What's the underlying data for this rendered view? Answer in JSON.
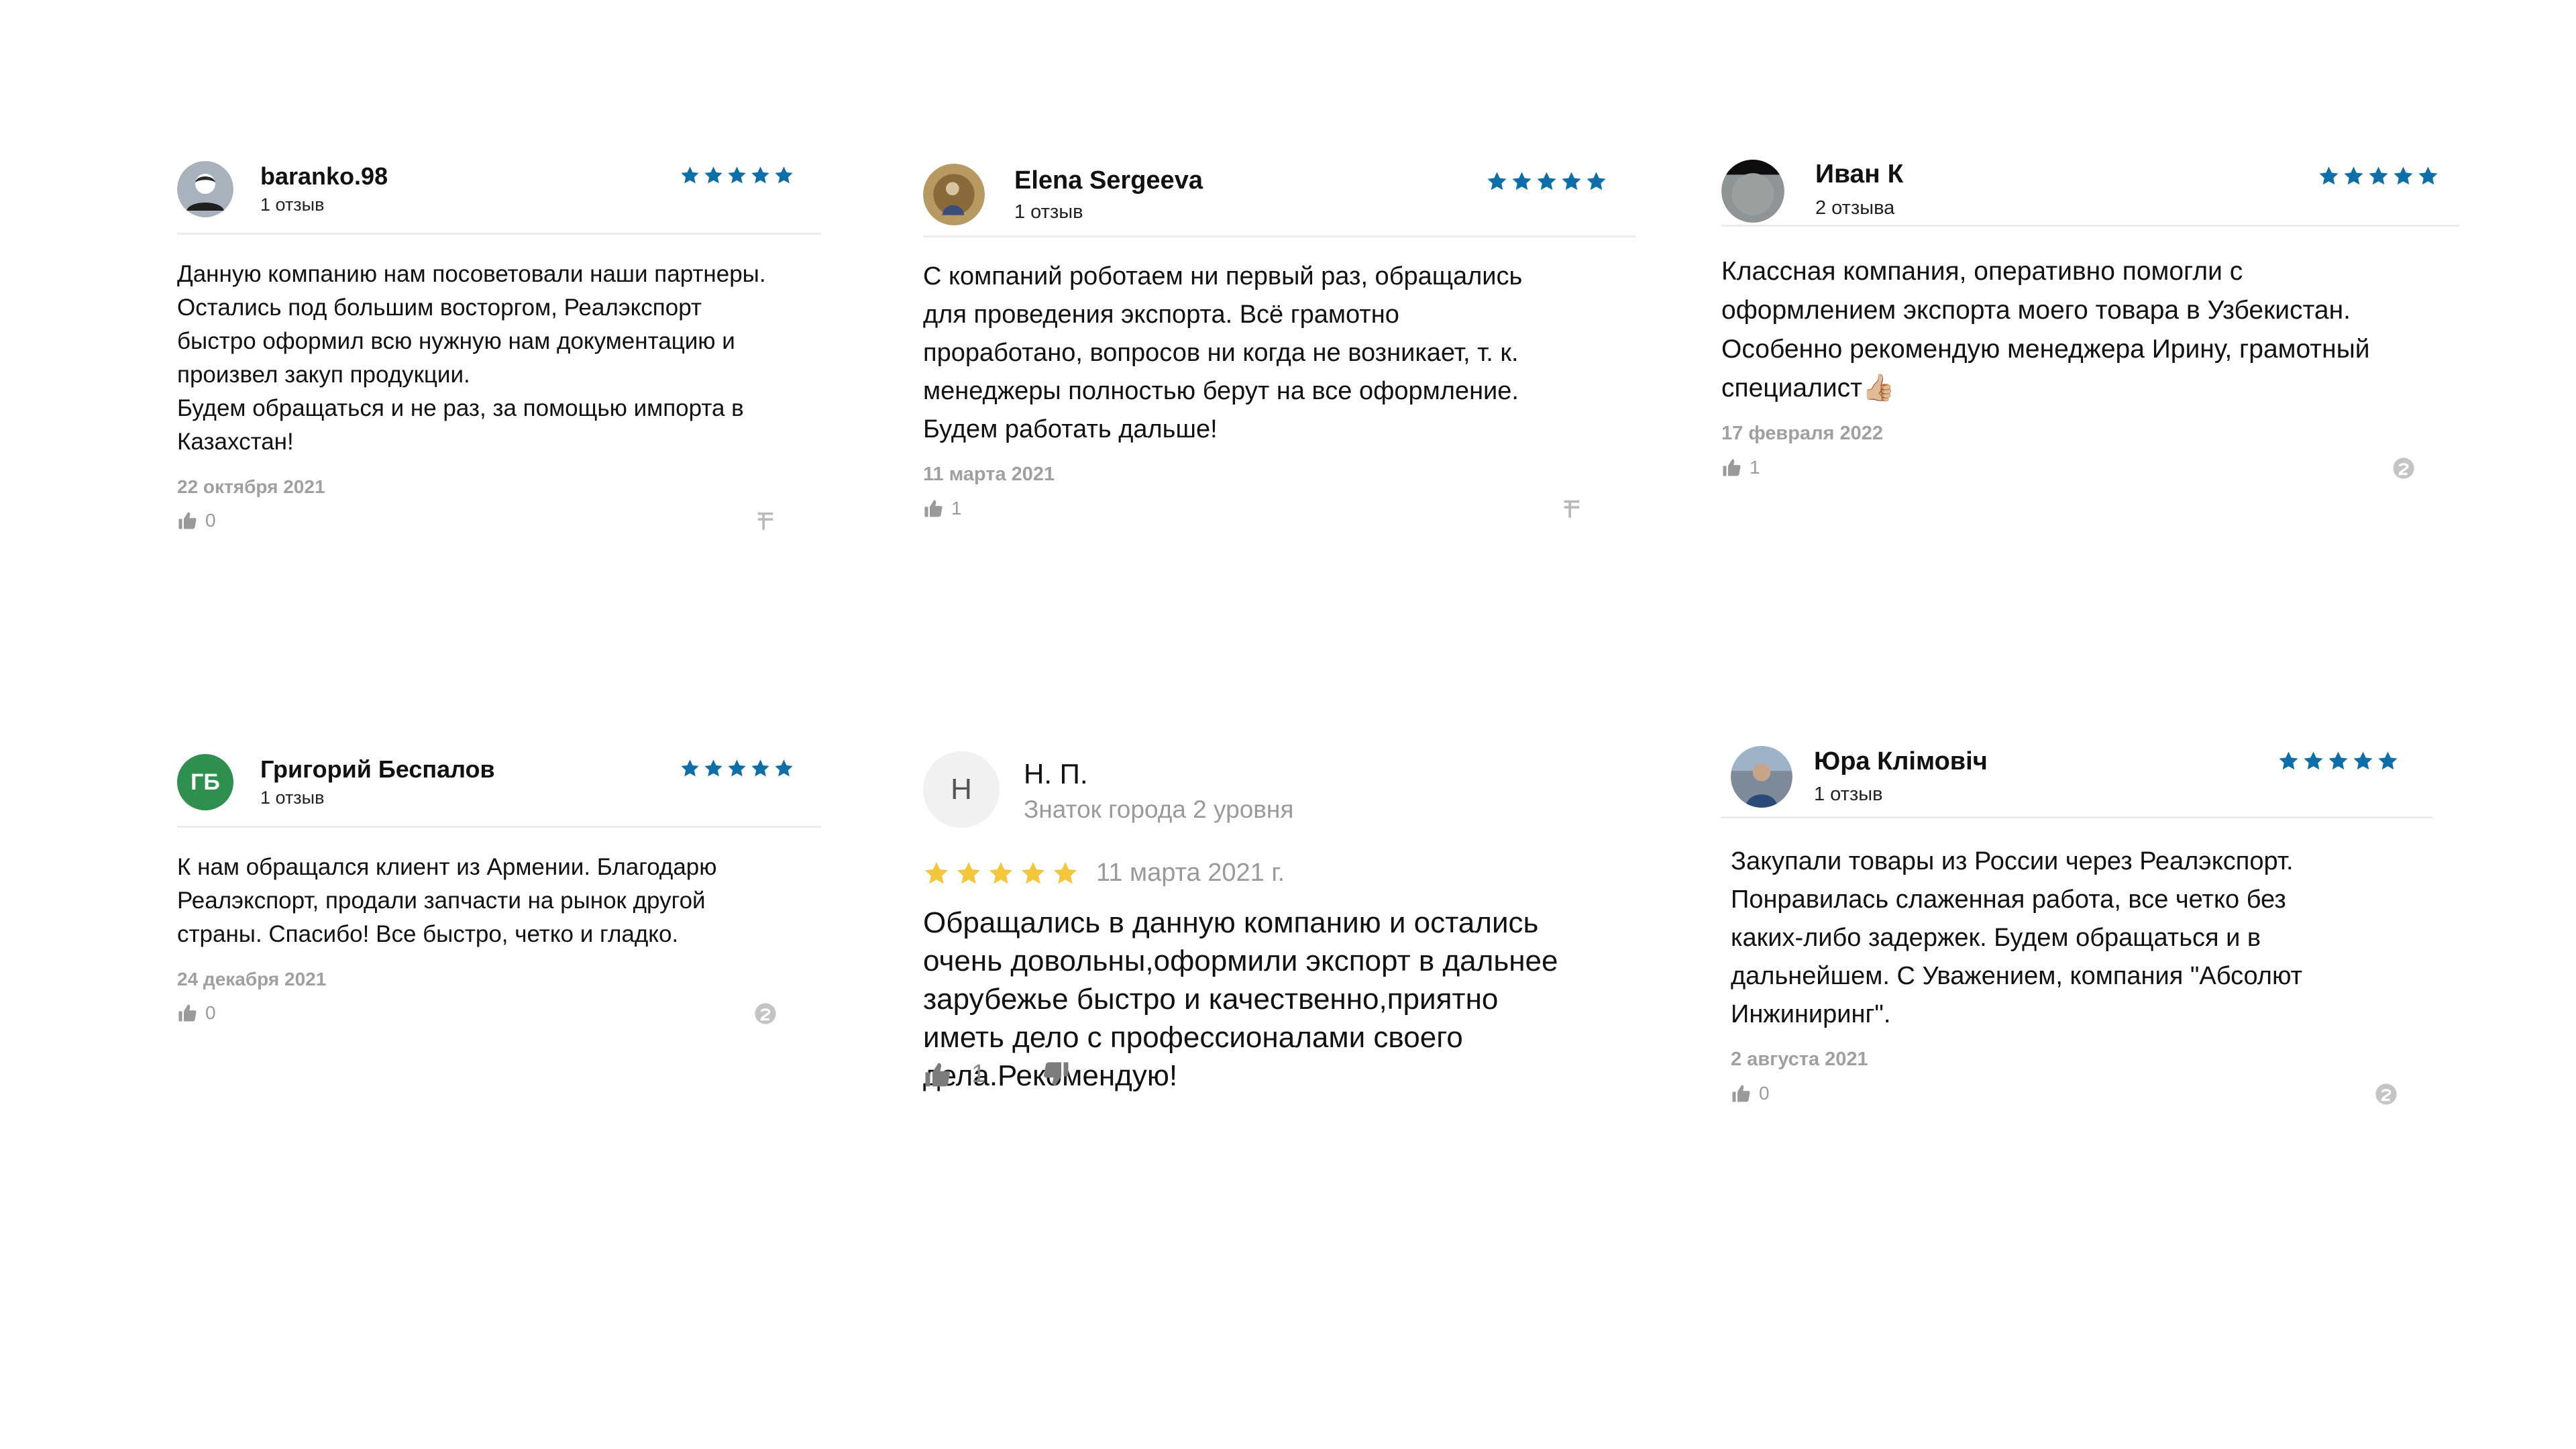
{
  "colors": {
    "star_blue": "#0e6fa8",
    "star_yellow": "#f4c63b",
    "muted_gray": "#a0a0a0",
    "initials_green": "#2f8f4e"
  },
  "reviews": [
    {
      "author": "baranko.98",
      "reviews_count": "1 отзыв",
      "rating": 5,
      "avatar_icon": "default-user-avatar",
      "text": "Данную компанию нам посоветовали наши партнеры.\nОстались под большим восторгом, Реалэкспорт\nбыстро оформил всю нужную нам документацию и\nпроизвел закуп продукции.\nБудем обращаться и не раз, за помощью импорта в\nКазахстан!",
      "date": "22 октября 2021",
      "likes": "0",
      "corner_icon": "flamp-icon"
    },
    {
      "author": "Elena Sergeeva",
      "reviews_count": "1 отзыв",
      "rating": 5,
      "avatar_icon": "photo-avatar",
      "text": "С компаний роботаем ни первый раз, обращались\nдля проведения экспорта. Всё грамотно\nпроработано, вопросов ни когда не возникает, т. к.\nменеджеры полностью берут на все оформление.\nБудем работать дальше!",
      "date": "11 марта 2021",
      "likes": "1",
      "corner_icon": "flamp-icon"
    },
    {
      "author": "Иван К",
      "reviews_count": "2 отзыва",
      "rating": 5,
      "avatar_icon": "photo-avatar",
      "text": "Классная компания, оперативно помогли с\nоформлением экспорта моего товара в Узбекистан.\nОсобенно рекомендую менеджера Ирину, грамотный\nспециалист👍🏼",
      "date": "17 февраля 2022",
      "likes": "1",
      "corner_icon": "2gis-icon"
    },
    {
      "author": "Григорий Беспалов",
      "reviews_count": "1 отзыв",
      "rating": 5,
      "avatar_initials": "ГБ",
      "text": "К нам обращался клиент из Армении. Благодарю\nРеалэкспорт, продали запчасти на рынок другой\nстраны. Спасибо! Все быстро, четко и гладко.",
      "date": "24 декабря 2021",
      "likes": "0",
      "corner_icon": "2gis-icon"
    },
    {
      "author": "Н. П.",
      "level": "Знаток города 2 уровня",
      "rating": 5,
      "avatar_initial": "Н",
      "text": "Обращались в данную компанию и остались\nочень довольны,оформили экспорт в дальнее\nзарубежье быстро и качественно,приятно\nиметь дело с профессионалами своего\nдела.Рекомендую!",
      "date": "11 марта 2021 г.",
      "likes": "1",
      "like_icon": "thumb-up-icon",
      "dislike_icon": "thumb-down-icon"
    },
    {
      "author": "Юра Клімовіч",
      "reviews_count": "1 отзыв",
      "rating": 5,
      "avatar_icon": "photo-avatar",
      "text": "Закупали товары из России через Реалэкспорт.\nПонравилась слаженная работа, все четко без\nкаких-либо задержек. Будем обращаться и в\nдальнейшем. С Уважением, компания \"Абсолют\nИнжиниринг\".",
      "date": "2 августа 2021",
      "likes": "0",
      "corner_icon": "2gis-icon"
    }
  ]
}
